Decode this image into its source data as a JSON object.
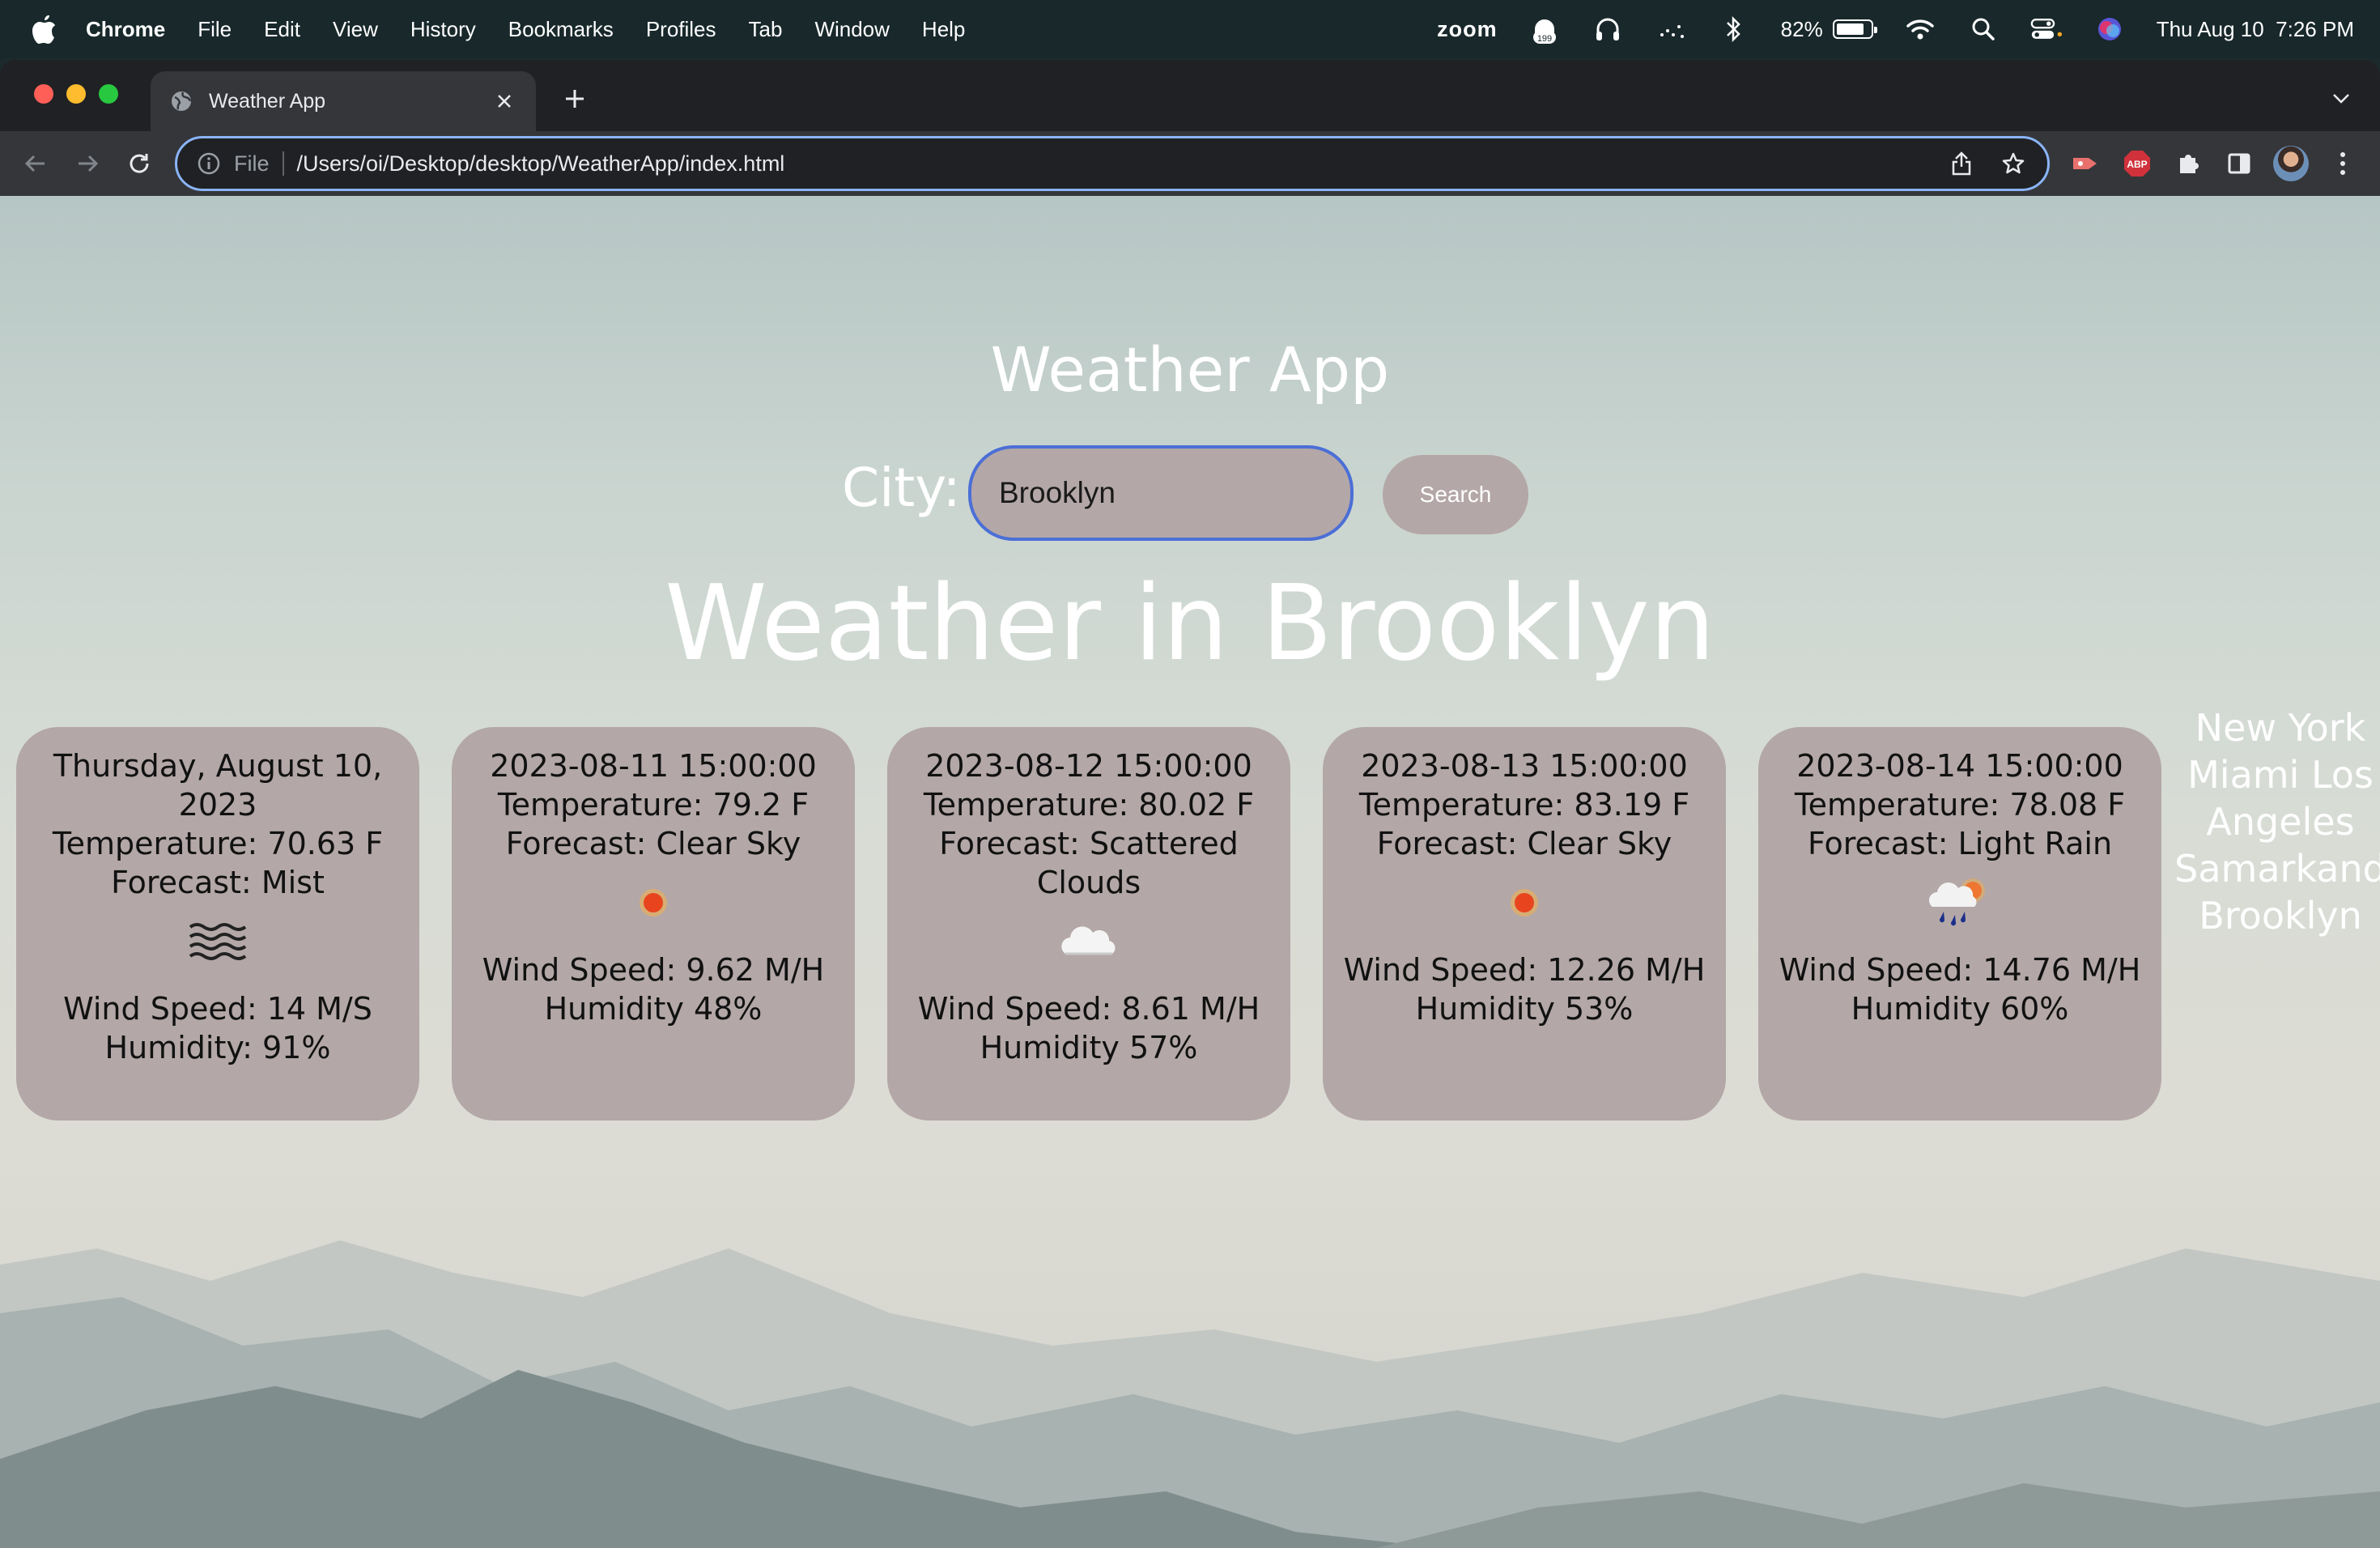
{
  "menubar": {
    "app_name": "Chrome",
    "menus": [
      "File",
      "Edit",
      "View",
      "History",
      "Bookmarks",
      "Profiles",
      "Tab",
      "Window",
      "Help"
    ],
    "zoom_label": "zoom",
    "notification_count": "199",
    "battery_percent": "82%",
    "battery_level": 0.82,
    "datetime": "Thu Aug 10  7:26 PM"
  },
  "browser": {
    "tab_title": "Weather App",
    "omnibox": {
      "scheme_label": "File",
      "url": "/Users/oi/Desktop/desktop/WeatherApp/index.html"
    },
    "extension_abp": "ABP"
  },
  "app": {
    "title": "Weather App",
    "city_label": "City:",
    "city_value": "Brooklyn",
    "search_label": "Search",
    "heading": "Weather in Brooklyn",
    "forecast": [
      {
        "date": "Thursday, August 10, 2023",
        "temperature": "Temperature: 70.63 F",
        "forecast": "Forecast: Mist",
        "icon": "mist-icon",
        "wind": "Wind Speed: 14 M/S",
        "humidity": "Humidity: 91%"
      },
      {
        "date": "2023-08-11 15:00:00",
        "temperature": "Temperature: 79.2 F",
        "forecast": "Forecast: Clear Sky",
        "icon": "sun-icon",
        "wind": "Wind Speed: 9.62 M/H",
        "humidity": "Humidity 48%"
      },
      {
        "date": "2023-08-12 15:00:00",
        "temperature": "Temperature: 80.02 F",
        "forecast": "Forecast: Scattered Clouds",
        "icon": "cloud-icon",
        "wind": "Wind Speed: 8.61 M/H",
        "humidity": "Humidity 57%"
      },
      {
        "date": "2023-08-13 15:00:00",
        "temperature": "Temperature: 83.19 F",
        "forecast": "Forecast: Clear Sky",
        "icon": "sun-icon",
        "wind": "Wind Speed: 12.26 M/H",
        "humidity": "Humidity 53%"
      },
      {
        "date": "2023-08-14 15:00:00",
        "temperature": "Temperature: 78.08 F",
        "forecast": "Forecast: Light Rain",
        "icon": "rain-icon",
        "wind": "Wind Speed: 14.76 M/H",
        "humidity": "Humidity 60%"
      }
    ],
    "cities": [
      "New York",
      "Miami",
      "Los Angeles",
      "Samarkand",
      "Brooklyn"
    ]
  }
}
